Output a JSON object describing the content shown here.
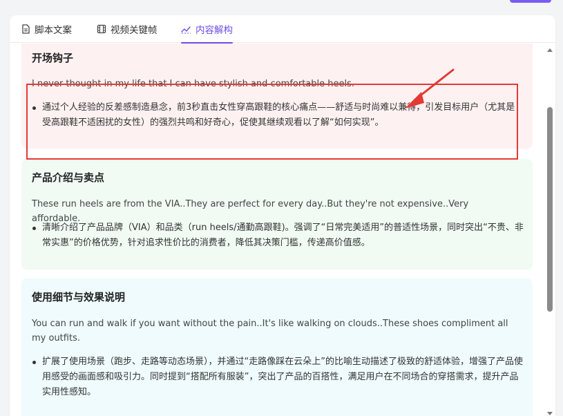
{
  "tabs": [
    {
      "label": "脚本文案",
      "icon": "document-icon"
    },
    {
      "label": "视频关键帧",
      "icon": "film-icon"
    },
    {
      "label": "内容解构",
      "icon": "trend-chart-icon",
      "active": true
    }
  ],
  "sections": [
    {
      "title": "开场钩子",
      "quote": "I never thought in my life that I can have stylish and comfortable heels.",
      "bullet": "通过个人经验的反差感制造悬念，前3秒直击女性穿高跟鞋的核心痛点——舒适与时尚难以兼得，引发目标用户（尤其是受高跟鞋不适困扰的女性）的强烈共鸣和好奇心，促使其继续观看以了解“如何实现”。",
      "color": "#fdf1f1"
    },
    {
      "title": "产品介绍与卖点",
      "quote": "These run heels are from the VIA..They are perfect for every day..But they're not expensive..Very affordable.",
      "bullet": "清晰介绍了产品品牌（VIA）和品类（run heels/通勤高跟鞋)。强调了“日常完美适用”的普适性场景，同时突出“不贵、非常实惠”的价格优势，针对追求性价比的消费者，降低其决策门槛，传递高价值感。",
      "color": "#f1faf3"
    },
    {
      "title": "使用细节与效果说明",
      "quote": "You can run and walk if you want without the pain..It's like walking on clouds..These shoes compliment all my outfits.",
      "bullet": "扩展了使用场景（跑步、走路等动态场景），并通过“走路像踩在云朵上”的比喻生动描述了极致的舒适体验，增强了产品使用感受的画面感和吸引力。同时提到“搭配所有服装”，突出了产品的百搭性，满足用户在不同场合的穿搭需求，提升产品实用性感知。",
      "color": "#effbfc"
    }
  ],
  "colors": {
    "accent": "#6b4ce6",
    "annotation": "#e53935"
  }
}
